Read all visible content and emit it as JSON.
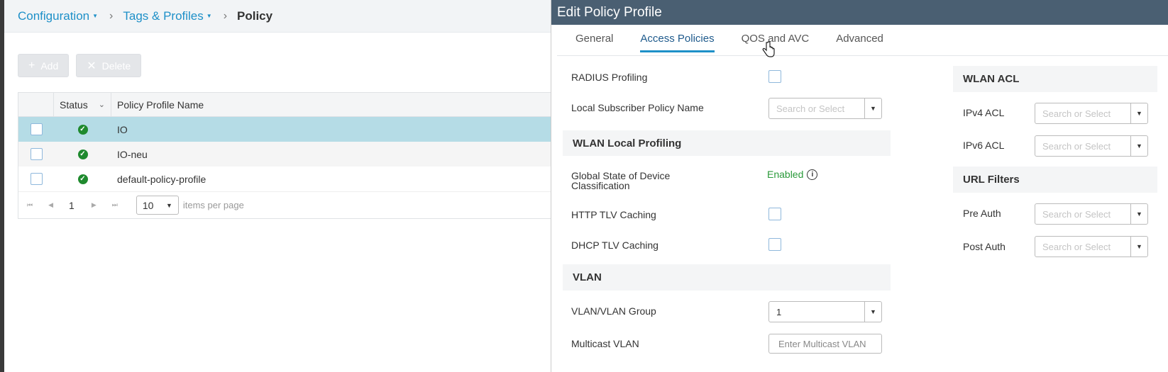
{
  "breadcrumb": {
    "items": [
      {
        "label": "Configuration",
        "dropdown": true
      },
      {
        "label": "Tags & Profiles",
        "dropdown": true
      },
      {
        "label": "Policy",
        "dropdown": false
      }
    ]
  },
  "toolbar": {
    "add_label": "Add",
    "delete_label": "Delete"
  },
  "table": {
    "columns": [
      "Status",
      "Policy Profile Name"
    ],
    "rows": [
      {
        "status": "ok",
        "name": "IO",
        "selected": true
      },
      {
        "status": "ok",
        "name": "IO-neu",
        "selected": false
      },
      {
        "status": "ok",
        "name": "default-policy-profile",
        "selected": false
      }
    ]
  },
  "pager": {
    "page": "1",
    "page_size": "10",
    "page_size_suffix": "items per page"
  },
  "panel": {
    "title": "Edit Policy Profile",
    "tabs": [
      "General",
      "Access Policies",
      "QOS and AVC",
      "Advanced"
    ],
    "active_tab": "Access Policies",
    "radius_profiling_label": "RADIUS Profiling",
    "local_subscriber_label": "Local Subscriber Policy Name",
    "search_placeholder": "Search or Select",
    "wlan_local_profiling": "WLAN Local Profiling",
    "global_state_label": "Global State of Device Classification",
    "global_state_value": "Enabled",
    "http_tlv_label": "HTTP TLV Caching",
    "dhcp_tlv_label": "DHCP TLV Caching",
    "vlan_section": "VLAN",
    "vlan_group_label": "VLAN/VLAN Group",
    "vlan_group_value": "1",
    "multicast_vlan_label": "Multicast VLAN",
    "multicast_vlan_placeholder": "Enter Multicast VLAN",
    "wlan_acl_section": "WLAN ACL",
    "ipv4_acl_label": "IPv4 ACL",
    "ipv6_acl_label": "IPv6 ACL",
    "url_filters_section": "URL Filters",
    "pre_auth_label": "Pre Auth",
    "post_auth_label": "Post Auth"
  },
  "colors": {
    "title_bar": "#4a5f72",
    "accent": "#1e90c8",
    "enabled": "#2a9a3a",
    "selected_row": "#b5dce6"
  }
}
